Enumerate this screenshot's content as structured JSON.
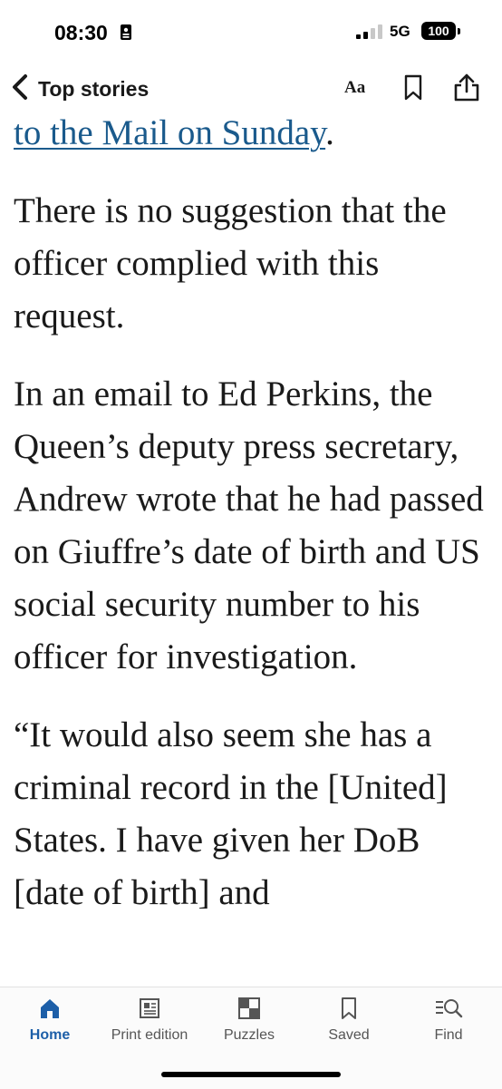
{
  "status_bar": {
    "time": "08:30",
    "network": "5G",
    "battery": "100"
  },
  "nav": {
    "back_label": "Top stories",
    "text_size_label": "Aa"
  },
  "article": {
    "link_text": "to the Mail on Sunday",
    "link_suffix": ".",
    "paragraphs": [
      "There is no suggestion that the officer complied with this request.",
      "In an email to Ed Perkins, the Queen’s deputy press secretary, Andrew wrote that he had passed on Giuffre’s date of birth and US social security number to his officer for investigation.",
      "“It would also seem she has a criminal record in the [United] States. I have given her DoB [date of birth] and"
    ]
  },
  "tabs": [
    {
      "label": "Home",
      "icon": "home-icon",
      "active": true
    },
    {
      "label": "Print edition",
      "icon": "newspaper-icon",
      "active": false
    },
    {
      "label": "Puzzles",
      "icon": "puzzle-icon",
      "active": false
    },
    {
      "label": "Saved",
      "icon": "bookmark-icon",
      "active": false
    },
    {
      "label": "Find",
      "icon": "search-icon",
      "active": false
    }
  ],
  "colors": {
    "accent": "#1d5fa8",
    "link": "#1a5a8c",
    "text": "#1a1a1a"
  }
}
